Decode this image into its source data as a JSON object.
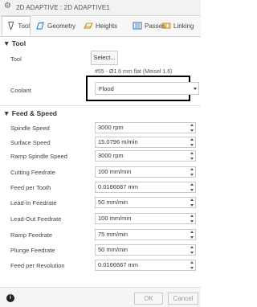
{
  "window": {
    "title": "2D ADAPTIVE : 2D ADAPTIVE1"
  },
  "tabs": [
    {
      "label": "Tool",
      "icon": "tool-icon",
      "active": true
    },
    {
      "label": "Geometry",
      "icon": "geometry-icon",
      "active": false
    },
    {
      "label": "Heights",
      "icon": "heights-icon",
      "active": false
    },
    {
      "label": "Passes",
      "icon": "passes-icon",
      "active": false
    },
    {
      "label": "Linking",
      "icon": "linking-icon",
      "active": false
    }
  ],
  "tool_section": {
    "title": "▼ Tool",
    "tool_label": "Tool",
    "tool_button": "Select...",
    "tool_desc": "#55 - Ø1.6 mm flat (Meisel 1.6)",
    "coolant_label": "Coolant",
    "coolant_value": "Flood"
  },
  "feed_section": {
    "title": "▼ Feed & Speed",
    "rows": [
      {
        "label": "Spindle Speed",
        "value": "3000 rpm"
      },
      {
        "label": "Surface Speed",
        "value": "15.0796 m/min"
      },
      {
        "label": "Ramp Spindle Speed",
        "value": "3000 rpm"
      },
      {
        "label": "Cutting Feedrate",
        "value": "100 mm/min"
      },
      {
        "label": "Feed per Tooth",
        "value": "0.0166667 mm"
      },
      {
        "label": "Lead-In Feedrate",
        "value": "50 mm/min"
      },
      {
        "label": "Lead-Out Feedrate",
        "value": "100 mm/min"
      },
      {
        "label": "Ramp Feedrate",
        "value": "75 mm/min"
      },
      {
        "label": "Plunge Feedrate",
        "value": "50 mm/min"
      },
      {
        "label": "Feed per Revolution",
        "value": "0.0166667 mm"
      }
    ]
  },
  "footer": {
    "ok": "OK",
    "cancel": "Cancel",
    "info_icon": "i"
  },
  "colors": {
    "highlight_border": "#000000",
    "field_border": "#c9c9c9"
  }
}
